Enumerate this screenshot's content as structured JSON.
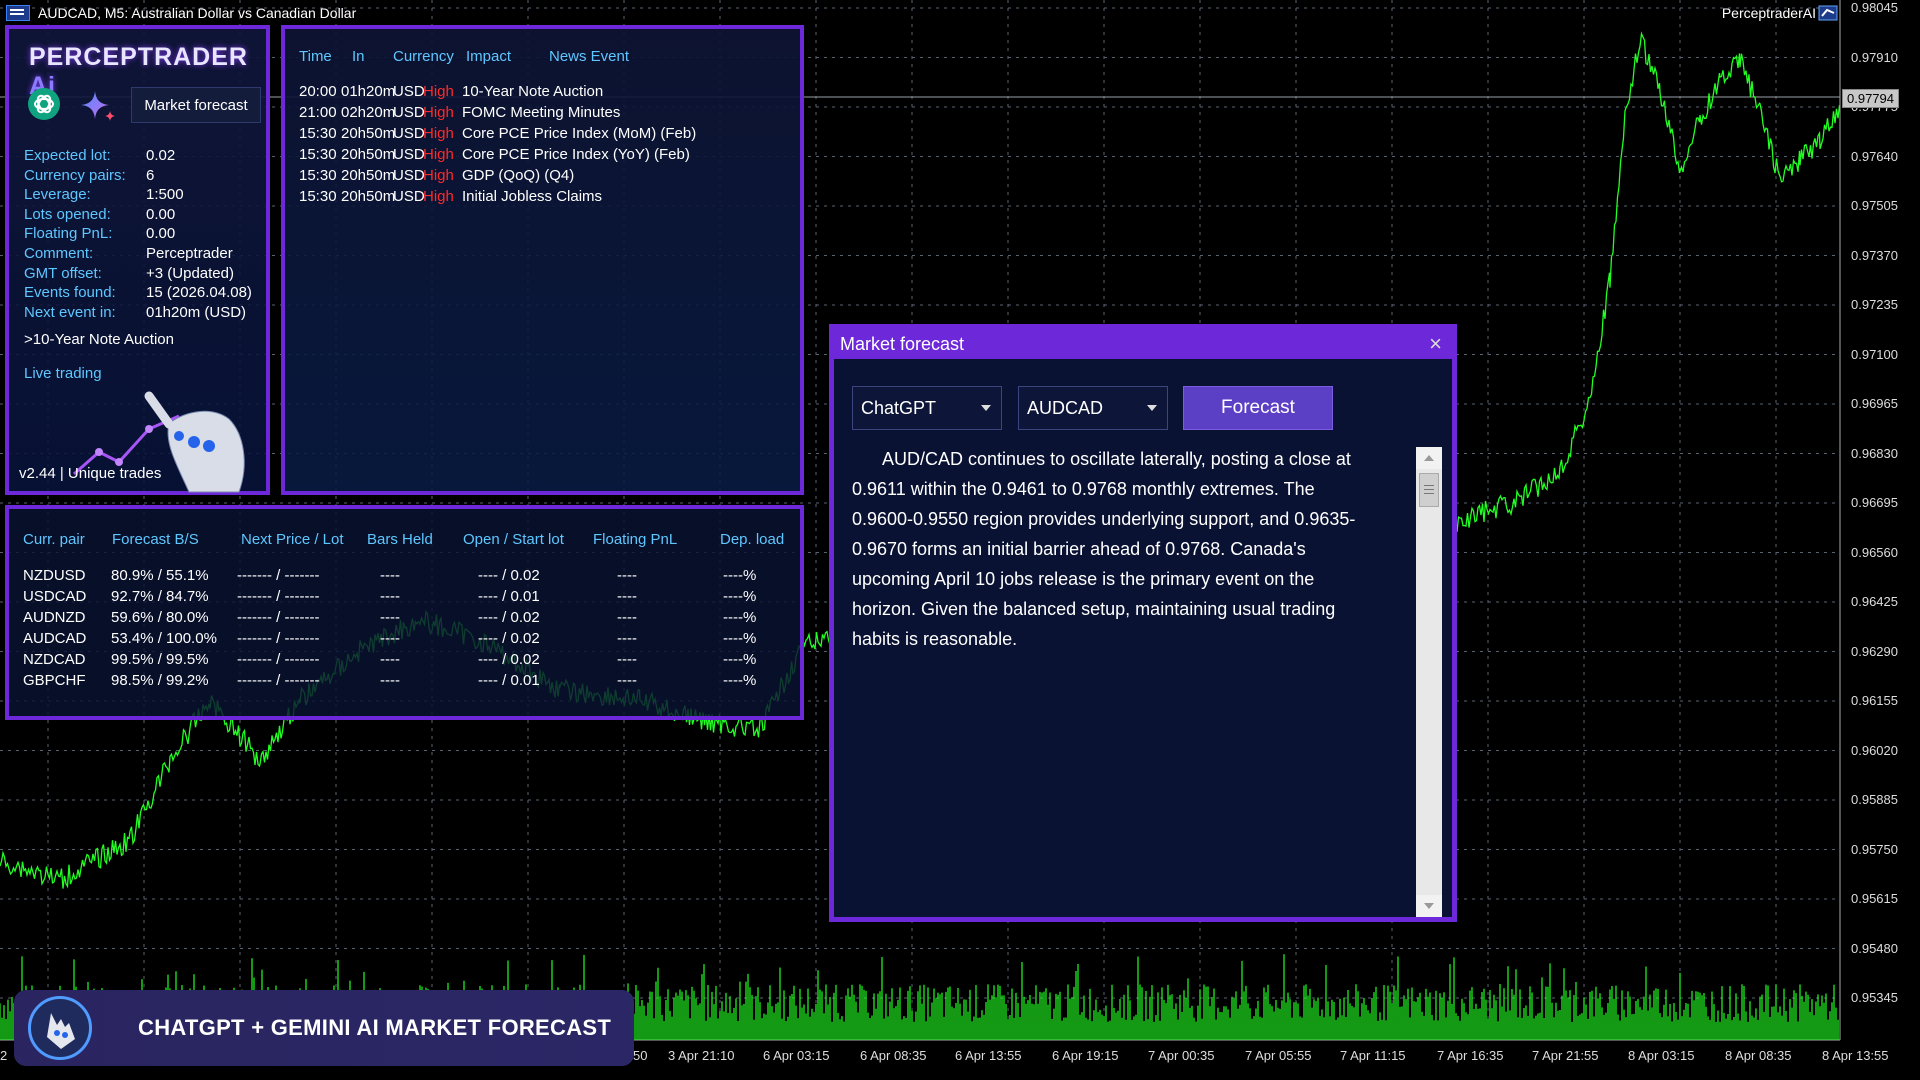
{
  "window": {
    "title": "AUDCAD, M5:  Australian Dollar vs Canadian Dollar",
    "expert_name": "PerceptraderAI"
  },
  "price_axis": [
    "0.98045",
    "0.97910",
    "0.97775",
    "0.97640",
    "0.97505",
    "0.97370",
    "0.97235",
    "0.97100",
    "0.96965",
    "0.96830",
    "0.96695",
    "0.96560",
    "0.96425",
    "0.96290",
    "0.96155",
    "0.96020",
    "0.95885",
    "0.95750",
    "0.95615",
    "0.95480",
    "0.95345"
  ],
  "current_price": "0.97794",
  "time_axis": [
    "2",
    "50",
    "3 Apr 21:10",
    "6 Apr 03:15",
    "6 Apr 08:35",
    "6 Apr 13:55",
    "6 Apr 19:15",
    "7 Apr 00:35",
    "7 Apr 05:55",
    "7 Apr 11:15",
    "7 Apr 16:35",
    "7 Apr 21:55",
    "8 Apr 03:15",
    "8 Apr 08:35",
    "8 Apr 13:55"
  ],
  "info_panel": {
    "logo_main": "PERCEPTRADER",
    "logo_ai": "Ai",
    "market_forecast_button": "Market forecast",
    "rows": [
      {
        "k": "Expected lot:",
        "v": "0.02"
      },
      {
        "k": "Currency pairs:",
        "v": "6"
      },
      {
        "k": "Leverage:",
        "v": "1:500"
      },
      {
        "k": "Lots opened:",
        "v": "0.00"
      },
      {
        "k": "Floating PnL:",
        "v": "0.00"
      },
      {
        "k": "Comment:",
        "v": "Perceptrader"
      },
      {
        "k": "GMT offset:",
        "v": "+3 (Updated)"
      },
      {
        "k": "Events found:",
        "v": "15 (2026.04.08)"
      },
      {
        "k": "Next event in:",
        "v": "01h20m (USD)"
      }
    ],
    "next_event": ">10-Year Note Auction",
    "live_trading": "Live trading",
    "version": "v2.44 | Unique trades"
  },
  "news": {
    "headers": {
      "time": "Time",
      "in": "In",
      "currency": "Currency",
      "impact": "Impact",
      "event": "News Event"
    },
    "rows": [
      {
        "time": "20:00",
        "in": "01h20m",
        "currency": "USD",
        "impact": "High",
        "event": "10-Year Note Auction"
      },
      {
        "time": "21:00",
        "in": "02h20m",
        "currency": "USD",
        "impact": "High",
        "event": "FOMC Meeting Minutes"
      },
      {
        "time": "15:30",
        "in": "20h50m",
        "currency": "USD",
        "impact": "High",
        "event": "Core PCE Price Index (MoM) (Feb)"
      },
      {
        "time": "15:30",
        "in": "20h50m",
        "currency": "USD",
        "impact": "High",
        "event": "Core PCE Price Index (YoY) (Feb)"
      },
      {
        "time": "15:30",
        "in": "20h50m",
        "currency": "USD",
        "impact": "High",
        "event": "GDP (QoQ) (Q4)"
      },
      {
        "time": "15:30",
        "in": "20h50m",
        "currency": "USD",
        "impact": "High",
        "event": "Initial Jobless Claims"
      }
    ]
  },
  "pairs": {
    "headers": {
      "pair": "Curr. pair",
      "forecast": "Forecast B/S",
      "next": "Next Price / Lot",
      "bars": "Bars Held",
      "open": "Open / Start lot",
      "pnl": "Floating PnL",
      "dep": "Dep. load"
    },
    "rows": [
      {
        "pair": "NZDUSD",
        "forecast": "80.9% / 55.1%",
        "next": "------- / -------",
        "bars": "----",
        "open": "---- / 0.02",
        "pnl": "----",
        "dep": "----%"
      },
      {
        "pair": "USDCAD",
        "forecast": "92.7% / 84.7%",
        "next": "------- / -------",
        "bars": "----",
        "open": "---- / 0.01",
        "pnl": "----",
        "dep": "----%"
      },
      {
        "pair": "AUDNZD",
        "forecast": "59.6% / 80.0%",
        "next": "------- / -------",
        "bars": "----",
        "open": "---- / 0.02",
        "pnl": "----",
        "dep": "----%"
      },
      {
        "pair": "AUDCAD",
        "forecast": "53.4% / 100.0%",
        "next": "------- / -------",
        "bars": "----",
        "open": "---- / 0.02",
        "pnl": "----",
        "dep": "----%"
      },
      {
        "pair": "NZDCAD",
        "forecast": "99.5% / 99.5%",
        "next": "------- / -------",
        "bars": "----",
        "open": "---- / 0.02",
        "pnl": "----",
        "dep": "----%"
      },
      {
        "pair": "GBPCHF",
        "forecast": "98.5% / 99.2%",
        "next": "------- / -------",
        "bars": "----",
        "open": "---- / 0.01",
        "pnl": "----",
        "dep": "----%"
      }
    ]
  },
  "dialog": {
    "title": "Market forecast",
    "close": "×",
    "model_select": "ChatGPT",
    "pair_select": "AUDCAD",
    "forecast_button": "Forecast",
    "text": "AUD/CAD continues to oscillate laterally, posting a close at 0.9611 within the 0.9461 to 0.9768 monthly extremes. The 0.9600-0.9550 region provides underlying support, and 0.9635-0.9670 forms an initial barrier ahead of 0.9768. Canada's upcoming April 10 jobs release is the primary event on the horizon. Given the balanced setup, maintaining usual trading habits is reasonable."
  },
  "banner": {
    "text": "CHATGPT + GEMINI AI MARKET FORECAST"
  },
  "colors": {
    "accent": "#6d28d9",
    "price_line": "#22ff22",
    "high_impact": "#ff2a2a",
    "label_blue": "#5fc7ff"
  }
}
